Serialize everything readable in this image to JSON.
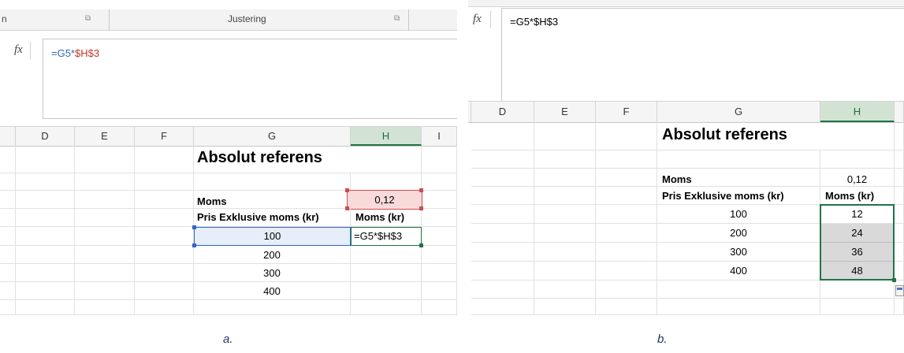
{
  "panel_a": {
    "ribbon": {
      "left_fragment": "n",
      "group_label": "Justering"
    },
    "formula_bar": {
      "fx": "fx",
      "part1": "=G5*",
      "part2": "$H$3"
    },
    "columns": [
      "D",
      "E",
      "F",
      "G",
      "H",
      "I"
    ],
    "sheet": {
      "title": "Absolut referens",
      "moms_label": "Moms",
      "moms_value": "0,12",
      "price_header": "Pris Exklusive moms (kr)",
      "moms_header": "Moms (kr)",
      "prices": [
        "100",
        "200",
        "300",
        "400"
      ],
      "editing_formula": "=G5*$H$3"
    }
  },
  "panel_b": {
    "formula_bar": {
      "fx": "fx",
      "formula": "=G5*$H$3"
    },
    "columns": [
      "D",
      "E",
      "F",
      "G",
      "H"
    ],
    "sheet": {
      "title": "Absolut referens",
      "moms_label": "Moms",
      "moms_value": "0,12",
      "price_header": "Pris Exklusive moms (kr)",
      "moms_header": "Moms (kr)",
      "prices": [
        "100",
        "200",
        "300",
        "400"
      ],
      "results": [
        "12",
        "24",
        "36",
        "48"
      ]
    }
  },
  "captions": {
    "a": "a.",
    "b": "b."
  },
  "colors": {
    "excel_green": "#217346",
    "ref_blue": "#3465c4",
    "ref_red": "#c0392b",
    "fill_selected": "#d9d9d9"
  }
}
